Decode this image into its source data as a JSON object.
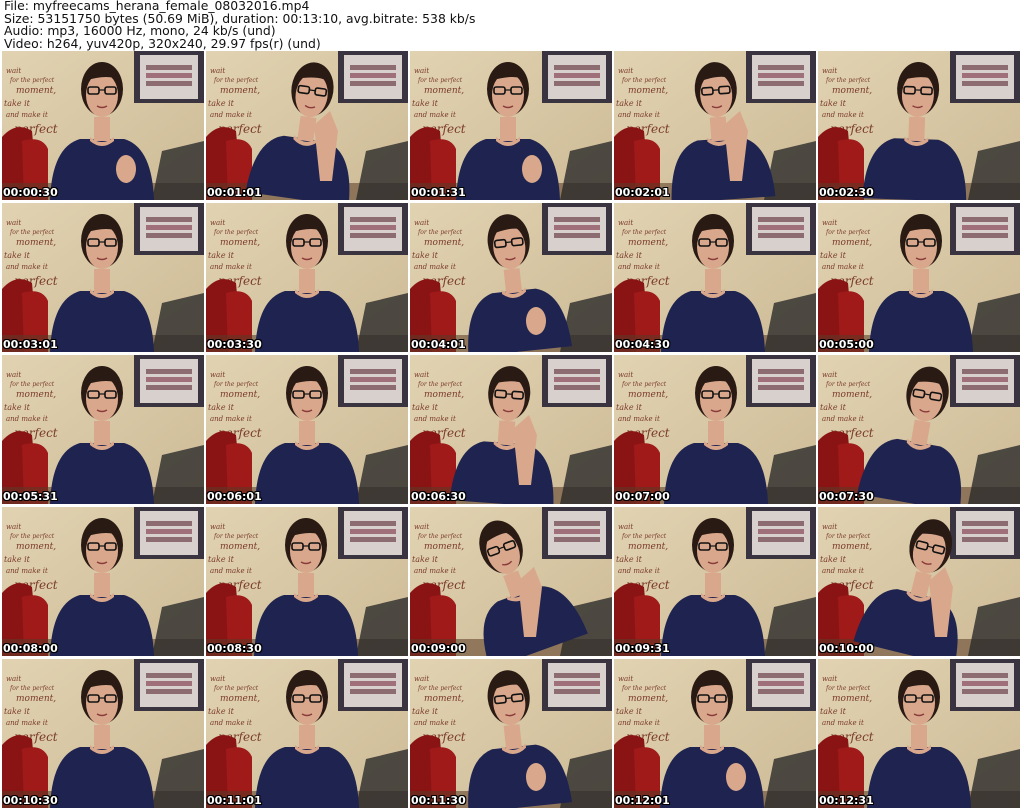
{
  "info": {
    "file": "File: myfreecams_herana_female_08032016.mp4",
    "size": "Size: 53151750 bytes (50.69 MiB), duration: 00:13:10, avg.bitrate: 538 kb/s",
    "audio": "Audio: mp3, 16000 Hz, mono, 24 kb/s (und)",
    "video": "Video: h264, yuv420p, 320x240, 29.97 fps(r) (und)"
  },
  "wall_text": {
    "line1": "wait",
    "line2": "for the perfect",
    "line3": "moment,",
    "line4": "take it",
    "line5": "and make it",
    "line6": "perfect"
  },
  "colors": {
    "wall": "#d8c8a4",
    "shirt": "#1e2350",
    "skin": "#d9a88c",
    "hair": "#2a1a14",
    "chair": "#8a1414",
    "frame": "#3a3440",
    "floor": "#5a3a26"
  },
  "thumbnails": [
    {
      "timestamp": "00:00:30"
    },
    {
      "timestamp": "00:01:01"
    },
    {
      "timestamp": "00:01:31"
    },
    {
      "timestamp": "00:02:01"
    },
    {
      "timestamp": "00:02:30"
    },
    {
      "timestamp": "00:03:01"
    },
    {
      "timestamp": "00:03:30"
    },
    {
      "timestamp": "00:04:01"
    },
    {
      "timestamp": "00:04:30"
    },
    {
      "timestamp": "00:05:00"
    },
    {
      "timestamp": "00:05:31"
    },
    {
      "timestamp": "00:06:01"
    },
    {
      "timestamp": "00:06:30"
    },
    {
      "timestamp": "00:07:00"
    },
    {
      "timestamp": "00:07:30"
    },
    {
      "timestamp": "00:08:00"
    },
    {
      "timestamp": "00:08:30"
    },
    {
      "timestamp": "00:09:00"
    },
    {
      "timestamp": "00:09:31"
    },
    {
      "timestamp": "00:10:00"
    },
    {
      "timestamp": "00:10:30"
    },
    {
      "timestamp": "00:11:01"
    },
    {
      "timestamp": "00:11:30"
    },
    {
      "timestamp": "00:12:01"
    },
    {
      "timestamp": "00:12:31"
    }
  ]
}
